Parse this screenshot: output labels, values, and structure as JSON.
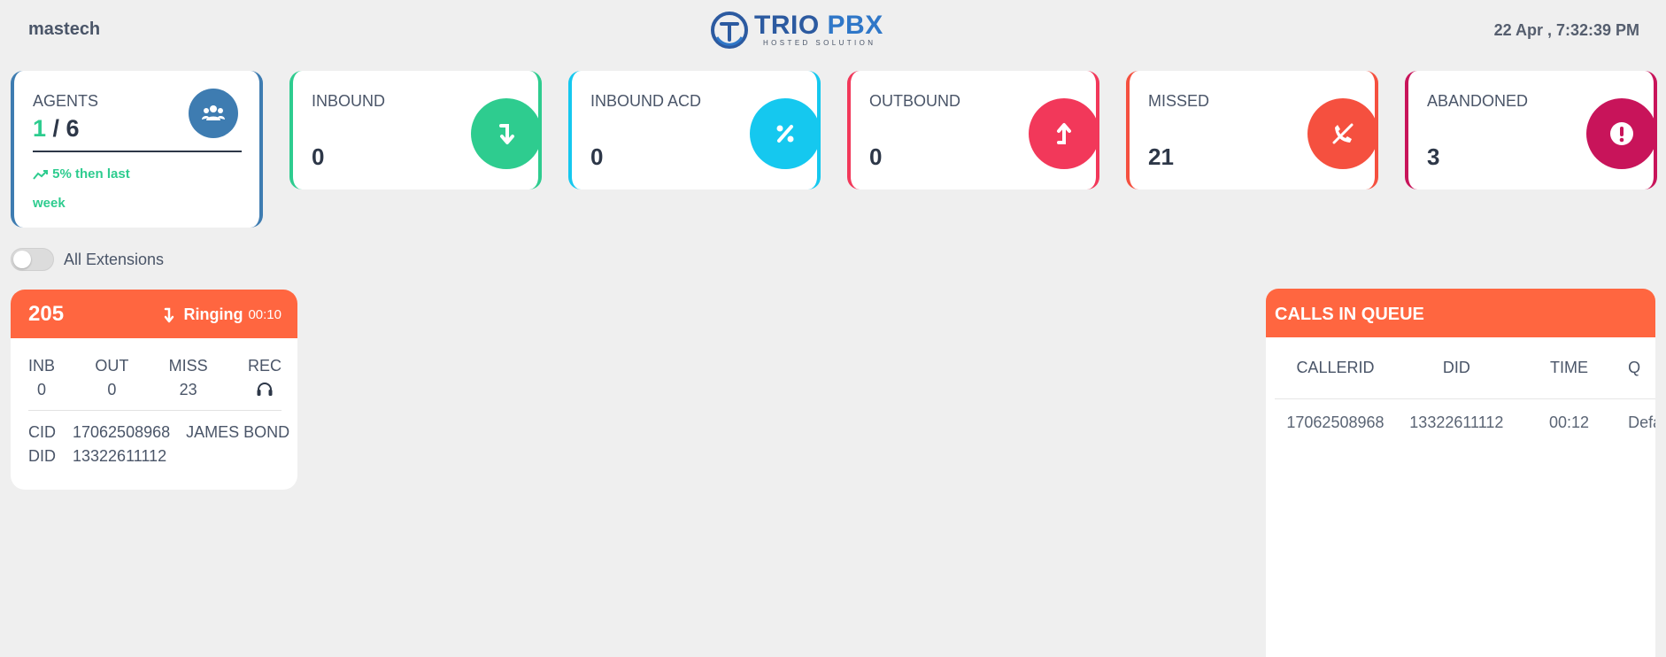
{
  "header": {
    "company": "mastech",
    "logo_title": "TRIO",
    "logo_title_accent": "PBX",
    "logo_subtitle": "HOSTED SOLUTION",
    "datetime": "22 Apr , 7:32:39 PM"
  },
  "agents": {
    "label": "AGENTS",
    "online": "1",
    "separator": " / ",
    "total": "6",
    "trend": "5% then last week",
    "icon": "users-icon",
    "color": "#3e7cb1"
  },
  "stats": [
    {
      "label": "INBOUND",
      "value": "0",
      "icon": "arrow-down-icon",
      "color": "#2ecc8f"
    },
    {
      "label": "INBOUND ACD",
      "value": "0",
      "icon": "percent-icon",
      "color": "#15c8ef"
    },
    {
      "label": "OUTBOUND",
      "value": "0",
      "icon": "arrow-up-icon",
      "color": "#f2385a"
    },
    {
      "label": "MISSED",
      "value": "21",
      "icon": "missed-call-icon",
      "color": "#f5503f"
    },
    {
      "label": "ABANDONED",
      "value": "3",
      "icon": "exclamation-icon",
      "color": "#c8145a"
    }
  ],
  "toggle": {
    "label": "All Extensions",
    "on": false
  },
  "extension": {
    "number": "205",
    "status": "Ringing",
    "timer": "00:10",
    "header_color": "#ff6640",
    "stats": [
      {
        "label": "INB",
        "value": "0"
      },
      {
        "label": "OUT",
        "value": "0"
      },
      {
        "label": "MISS",
        "value": "23"
      },
      {
        "label": "REC",
        "icon": "headphones-icon"
      }
    ],
    "cid_label": "CID",
    "cid": "17062508968",
    "caller_name": "JAMES BOND",
    "did_label": "DID",
    "did": "13322611112"
  },
  "queue": {
    "title": "CALLS IN QUEUE",
    "columns": [
      "CALLERID",
      "DID",
      "TIME",
      "Q"
    ],
    "rows": [
      {
        "callerid": "17062508968",
        "did": "13322611112",
        "time": "00:12",
        "queue": "Defa"
      }
    ]
  }
}
